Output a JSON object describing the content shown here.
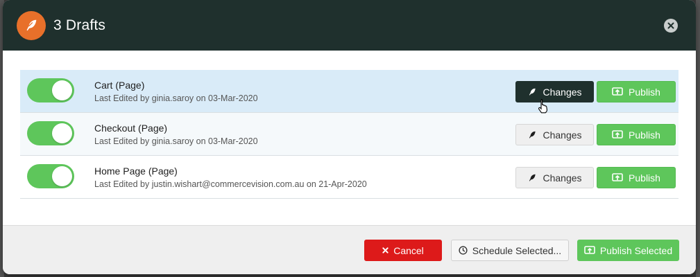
{
  "modal": {
    "title": "3 Drafts",
    "brand_color": "#e8702a",
    "header_color": "#1f302d"
  },
  "drafts": [
    {
      "name": "Cart (Page)",
      "meta": "Last Edited by ginia.saroy on 03-Mar-2020",
      "toggle_on": true,
      "changes_label": "Changes",
      "publish_label": "Publish"
    },
    {
      "name": "Checkout (Page)",
      "meta": "Last Edited by ginia.saroy on 03-Mar-2020",
      "toggle_on": true,
      "changes_label": "Changes",
      "publish_label": "Publish"
    },
    {
      "name": "Home Page (Page)",
      "meta": "Last Edited by justin.wishart@commercevision.com.au on 21-Apr-2020",
      "toggle_on": true,
      "changes_label": "Changes",
      "publish_label": "Publish"
    }
  ],
  "footer": {
    "cancel_label": "Cancel",
    "schedule_label": "Schedule Selected...",
    "publish_selected_label": "Publish Selected"
  },
  "colors": {
    "toggle_on": "#5ec65b",
    "publish": "#5ec65b",
    "cancel": "#dd1a1a",
    "row_highlight": "#d9ebf8"
  },
  "icons": {
    "brand": "feather-icon",
    "close": "close-icon",
    "changes": "feather-icon",
    "publish": "upload-icon",
    "cancel": "x-icon",
    "schedule": "clock-icon"
  }
}
